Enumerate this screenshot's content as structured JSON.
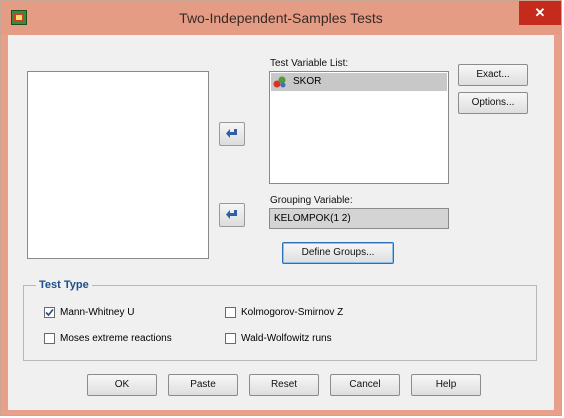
{
  "window": {
    "title": "Two-Independent-Samples Tests",
    "close_glyph": "✕",
    "titlebar_color": "#e59c85",
    "close_color": "#c42b1c",
    "accent_color": "#1f4e8c"
  },
  "buttons": {
    "exact": "Exact...",
    "options": "Options...",
    "define_groups": "Define Groups..."
  },
  "test_variable_list": {
    "label": "Test Variable List:",
    "items": [
      "SKOR"
    ]
  },
  "grouping_variable": {
    "label": "Grouping Variable:",
    "value": "KELOMPOK(1 2)"
  },
  "test_type": {
    "title": "Test Type",
    "options": [
      {
        "label": "Mann-Whitney U",
        "checked": true
      },
      {
        "label": "Kolmogorov-Smirnov Z",
        "checked": false
      },
      {
        "label": "Moses extreme reactions",
        "checked": false
      },
      {
        "label": "Wald-Wolfowitz runs",
        "checked": false
      }
    ]
  },
  "footer": {
    "ok": "OK",
    "paste": "Paste",
    "reset": "Reset",
    "cancel": "Cancel",
    "help": "Help"
  },
  "icons": {
    "app": "spss-dialog-icon",
    "variable": "scale-variable-icon",
    "move": "move-arrow-icon"
  }
}
